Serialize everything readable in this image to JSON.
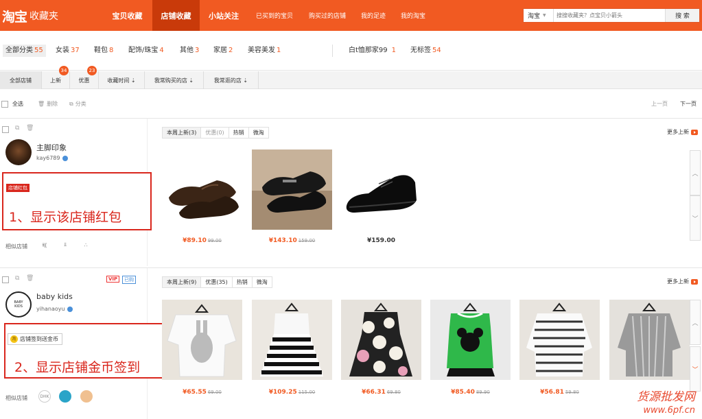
{
  "header": {
    "logo": "淘宝",
    "logo_sub": "收藏夹",
    "nav": [
      {
        "label": "宝贝收藏"
      },
      {
        "label": "店铺收藏"
      },
      {
        "label": "小站关注"
      },
      {
        "label": "已买到的宝贝"
      },
      {
        "label": "购买过的店铺"
      },
      {
        "label": "我的足迹"
      },
      {
        "label": "我的淘宝"
      }
    ],
    "search": {
      "scope": "淘宝",
      "placeholder": "搜搜收藏夹？点宝贝小箭头",
      "button": "搜 索"
    }
  },
  "categories": [
    {
      "label": "全部分类",
      "count": "55"
    },
    {
      "label": "女装",
      "count": "37"
    },
    {
      "label": "鞋包",
      "count": "8"
    },
    {
      "label": "配饰/珠宝",
      "count": "4"
    },
    {
      "label": "其他",
      "count": "3"
    },
    {
      "label": "家居",
      "count": "2"
    },
    {
      "label": "美容美发",
      "count": "1"
    },
    {
      "label": "白t恤那家99",
      "count": "1"
    },
    {
      "label": "无标签",
      "count": "54"
    }
  ],
  "filter_tabs": [
    {
      "label": "全部店铺"
    },
    {
      "label": "上新",
      "badge": "34"
    },
    {
      "label": "优惠",
      "badge": "23"
    },
    {
      "label": "收藏时间 ⇣"
    },
    {
      "label": "我常购买的店 ⇣"
    },
    {
      "label": "我常逛的店 ⇣"
    }
  ],
  "toolbar": {
    "select_all": "全选",
    "delete": "删除",
    "classify": "分类",
    "prev": "上一页",
    "next": "下一页"
  },
  "shops": [
    {
      "name": "主脚印象",
      "seller": "kay6789",
      "tag": "店铺红包",
      "annotation": "1、显示该店铺红包",
      "similar_label": "相似店铺",
      "tabs": [
        {
          "label": "本周上新",
          "count": "(3)"
        },
        {
          "label": "优惠",
          "count": "(0)"
        },
        {
          "label": "热销",
          "count": ""
        },
        {
          "label": "微淘",
          "count": ""
        }
      ],
      "more": "更多上新",
      "products": [
        {
          "price": "¥89.10",
          "old": "99.00"
        },
        {
          "price": "¥143.10",
          "old": "159.00"
        },
        {
          "price": "¥159.00",
          "old": ""
        }
      ]
    },
    {
      "name": "baby kids",
      "seller": "yihanaoyu",
      "avatar_text": "BABY KIDS",
      "vip": "VIP",
      "vip2": "已购",
      "tag": "店铺签到送金币",
      "coin": "淘",
      "annotation": "2、显示店铺金币签到",
      "similar_label": "相似店铺",
      "tabs": [
        {
          "label": "本周上新",
          "count": "(9)"
        },
        {
          "label": "优惠",
          "count": "(35)"
        },
        {
          "label": "热销",
          "count": ""
        },
        {
          "label": "微淘",
          "count": ""
        }
      ],
      "more": "更多上新",
      "products": [
        {
          "price": "¥65.55",
          "old": "69.00"
        },
        {
          "price": "¥109.25",
          "old": "115.00"
        },
        {
          "price": "¥66.31",
          "old": "69.80"
        },
        {
          "price": "¥85.40",
          "old": "89.90"
        },
        {
          "price": "¥56.81",
          "old": "59.80"
        },
        {
          "price": "",
          "old": ""
        }
      ]
    }
  ],
  "watermark": {
    "line1": "货源批发网",
    "line2": "www.6pf.cn"
  },
  "colors": {
    "brand": "#f15a22",
    "annotation": "#d9261c"
  }
}
